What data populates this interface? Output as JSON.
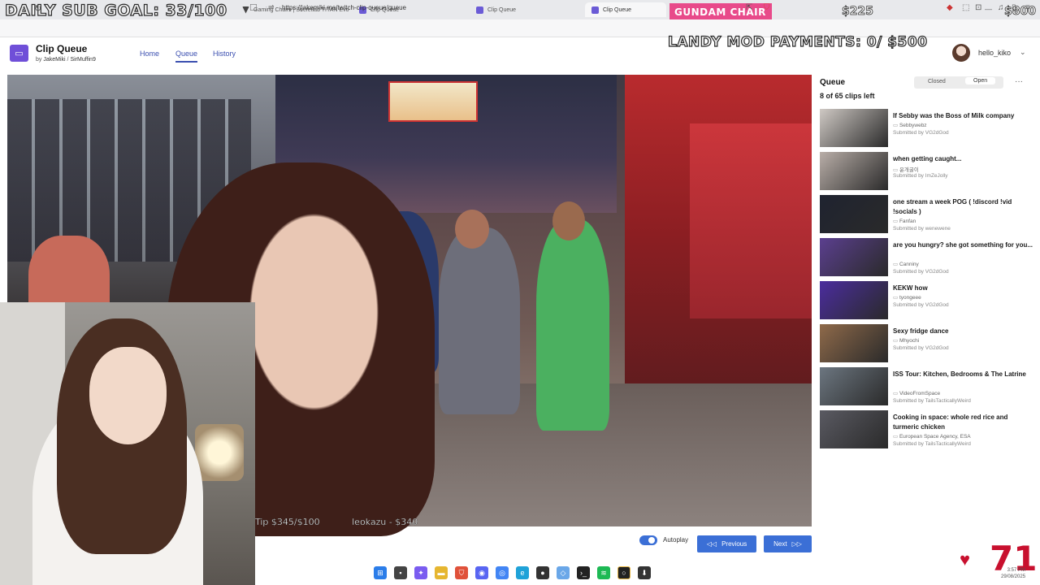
{
  "tabs": [
    {
      "label": "Gaming Chairs | Secretlab TITAN Evo",
      "active": false
    },
    {
      "label": "Clip Queue",
      "active": false
    },
    {
      "label": "Clip Queue",
      "active": false
    },
    {
      "label": "Clip Queue",
      "active": true
    }
  ],
  "overlays": {
    "sub_goal": "DAILY SUB GOAL: 33/100",
    "gundam": "GUNDAM CHAIR",
    "amount_a": "$225",
    "amount_b": "$800",
    "mod_payments": "LANDY MOD PAYMENTS: 0/ $500",
    "tip_line": "Tip $345/$100",
    "tip_user": "leokazu - $340",
    "big_count": "71"
  },
  "address": {
    "url": "https://jakemiki.me/twitch-clip-queue/queue"
  },
  "app": {
    "title": "Clip Queue",
    "by_label": "by",
    "author1": "JakeMiki",
    "separator": "/",
    "author2": "SirMuffin9",
    "nav": [
      "Home",
      "Queue",
      "History"
    ],
    "user": "hello_kiko"
  },
  "queue": {
    "title": "Queue",
    "closed_label": "Closed",
    "open_label": "Open",
    "more": "···",
    "count": "8 of 65 clips left",
    "clips": [
      {
        "title": "If Sebby was the Boss of Milk company",
        "author": "Sebbywebz",
        "submitted": "Submitted by VG2dGod",
        "thumb_color": "#cfc9c4"
      },
      {
        "title": "when getting caught...",
        "author": "윤개굴이",
        "submitted": "Submitted by ImZeJolly",
        "thumb_color": "#b9aea8"
      },
      {
        "title": "one stream a week POG ( !discord !vid !socials )",
        "author": "Fanfan",
        "submitted": "Submitted by wenewene",
        "thumb_color": "#1f2330"
      },
      {
        "title": "are you hungry? she got something for you...",
        "author": "Canniny",
        "submitted": "Submitted by VG2dGod",
        "thumb_color": "#5b3f8f"
      },
      {
        "title": "KEKW how",
        "author": "tyongeee",
        "submitted": "Submitted by VG2dGod",
        "thumb_color": "#4b2d9e"
      },
      {
        "title": "Sexy fridge dance",
        "author": "Mhyochi",
        "submitted": "Submitted by VG2dGod",
        "thumb_color": "#8f6a4a"
      },
      {
        "title": "ISS Tour: Kitchen, Bedrooms & The Latrine",
        "author": "VideoFromSpace",
        "submitted": "Submitted by TailsTacticallyWeird",
        "thumb_color": "#6c7680"
      },
      {
        "title": "Cooking in space: whole red rice and turmeric chicken",
        "author": "European Space Agency, ESA",
        "submitted": "Submitted by TailsTacticallyWeird",
        "thumb_color": "#5a5a62"
      }
    ]
  },
  "controls": {
    "autoplay": "Autoplay",
    "autoplay_on": true,
    "previous": "Previous",
    "next": "Next"
  },
  "clock": {
    "time": "3:57 PM",
    "date": "29/08/2025"
  },
  "colors": {
    "accent": "#3b6fd6",
    "brand": "#6f4fd8",
    "gundam": "#e84a8a",
    "counter": "#c8102e"
  }
}
